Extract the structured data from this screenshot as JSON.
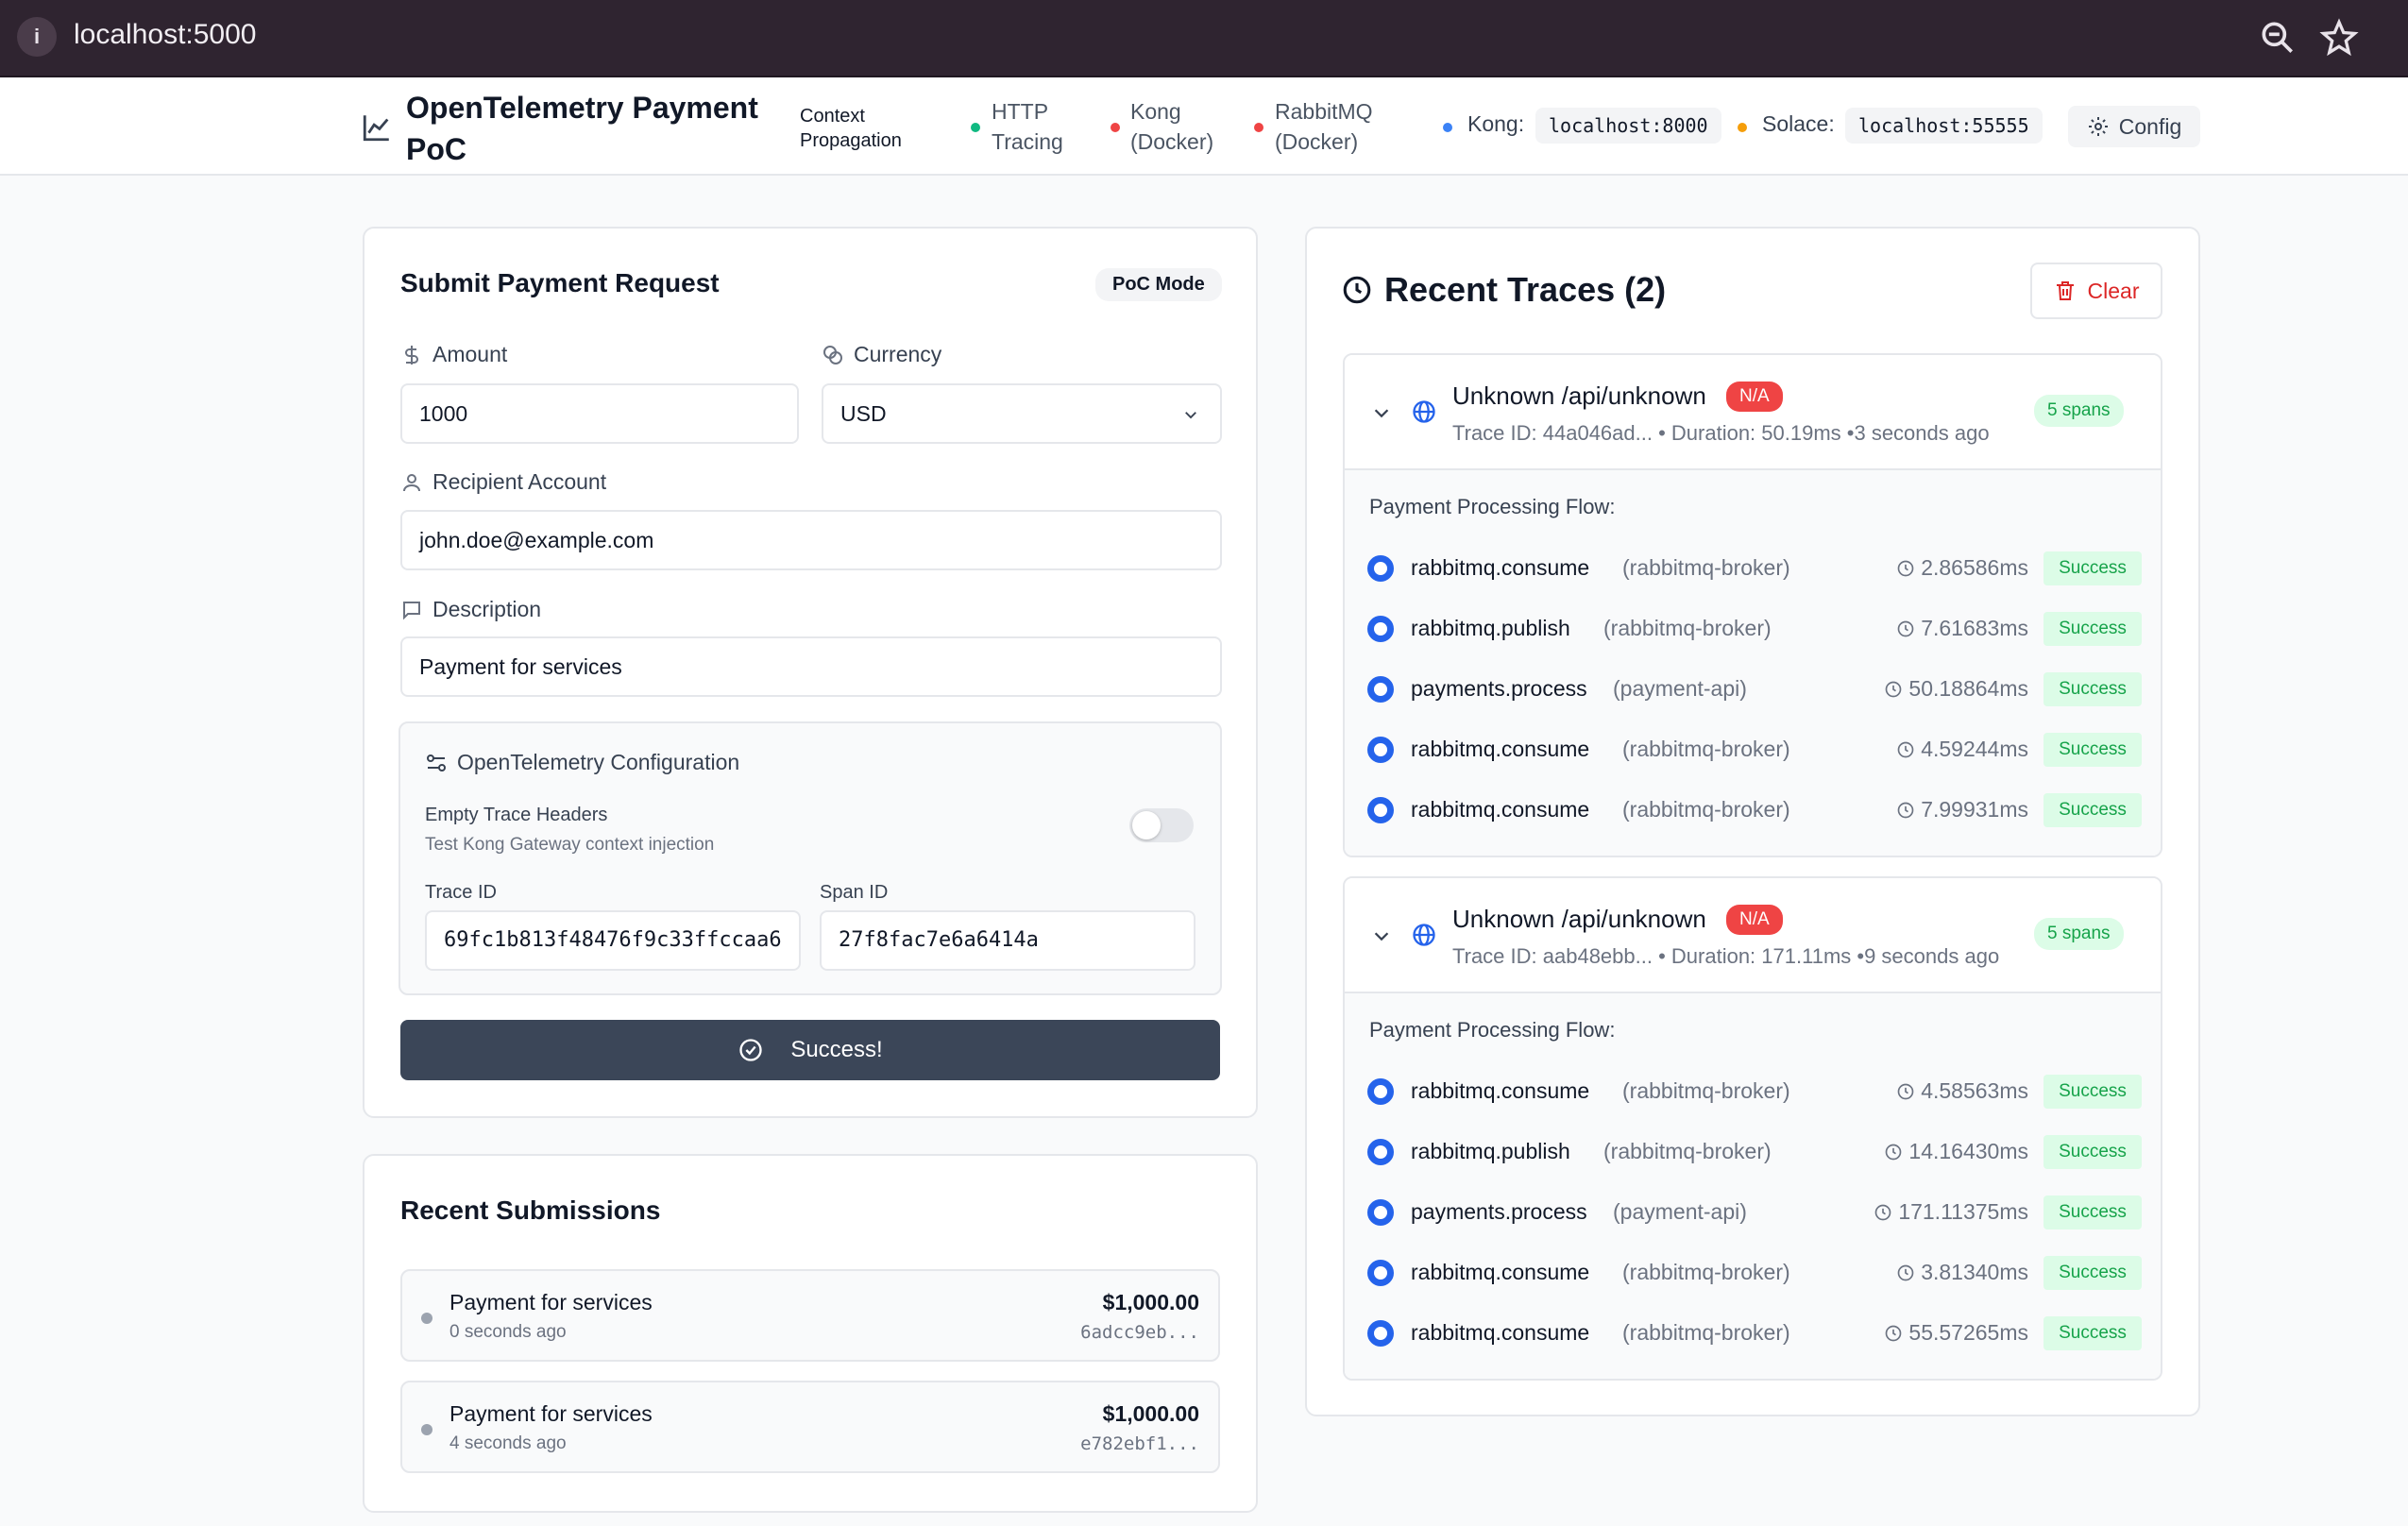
{
  "browser": {
    "url": "localhost:5000"
  },
  "header": {
    "title": "OpenTelemetry Payment PoC",
    "context_propagation": "Context Propagation",
    "http_tracing": "HTTP Tracing",
    "kong_docker": "Kong (Docker)",
    "rabbitmq_docker": "RabbitMQ (Docker)",
    "kong_label": "Kong:",
    "kong_endpoint": "localhost:8000",
    "solace_label": "Solace:",
    "solace_endpoint": "localhost:55555",
    "config_label": "Config",
    "colors": {
      "http": "#10b981",
      "kong": "#ef4444",
      "rabbitmq": "#ef4444",
      "kong_dot": "#3b82f6",
      "solace_dot": "#f59e0b"
    }
  },
  "form": {
    "title": "Submit Payment Request",
    "mode_badge": "PoC Mode",
    "amount_label": "Amount",
    "amount_value": "1000",
    "currency_label": "Currency",
    "currency_value": "USD",
    "recipient_label": "Recipient Account",
    "recipient_value": "john.doe@example.com",
    "description_label": "Description",
    "description_value": "Payment for services",
    "otel": {
      "title": "OpenTelemetry Configuration",
      "empty_headers_label": "Empty Trace Headers",
      "empty_headers_hint": "Test Kong Gateway context injection",
      "empty_headers_enabled": false,
      "trace_id_label": "Trace ID",
      "trace_id_value": "69fc1b813f48476f9c33ffccaa6",
      "span_id_label": "Span ID",
      "span_id_value": "27f8fac7e6a6414a"
    },
    "submit_label": "Success!"
  },
  "submissions": {
    "title": "Recent Submissions",
    "items": [
      {
        "title": "Payment for services",
        "time": "0 seconds ago",
        "amount": "$1,000.00",
        "hash": "6adcc9eb..."
      },
      {
        "title": "Payment for services",
        "time": "4 seconds ago",
        "amount": "$1,000.00",
        "hash": "e782ebf1..."
      }
    ]
  },
  "traces": {
    "title": "Recent Traces (2)",
    "clear_label": "Clear",
    "flow_label": "Payment Processing Flow:",
    "items": [
      {
        "name": "Unknown /api/unknown",
        "badge": "N/A",
        "meta": "Trace ID: 44a046ad... • Duration: 50.19ms •3 seconds ago",
        "spans_badge": "5 spans",
        "spans": [
          {
            "name": "rabbitmq.consume",
            "service": "(rabbitmq-broker)",
            "duration": "2.86586ms",
            "status": "Success"
          },
          {
            "name": "rabbitmq.publish",
            "service": "(rabbitmq-broker)",
            "duration": "7.61683ms",
            "status": "Success"
          },
          {
            "name": "payments.process",
            "service": "(payment-api)",
            "duration": "50.18864ms",
            "status": "Success"
          },
          {
            "name": "rabbitmq.consume",
            "service": "(rabbitmq-broker)",
            "duration": "4.59244ms",
            "status": "Success"
          },
          {
            "name": "rabbitmq.consume",
            "service": "(rabbitmq-broker)",
            "duration": "7.99931ms",
            "status": "Success"
          }
        ]
      },
      {
        "name": "Unknown /api/unknown",
        "badge": "N/A",
        "meta": "Trace ID: aab48ebb... • Duration: 171.11ms •9 seconds ago",
        "spans_badge": "5 spans",
        "spans": [
          {
            "name": "rabbitmq.consume",
            "service": "(rabbitmq-broker)",
            "duration": "4.58563ms",
            "status": "Success"
          },
          {
            "name": "rabbitmq.publish",
            "service": "(rabbitmq-broker)",
            "duration": "14.16430ms",
            "status": "Success"
          },
          {
            "name": "payments.process",
            "service": "(payment-api)",
            "duration": "171.11375ms",
            "status": "Success"
          },
          {
            "name": "rabbitmq.consume",
            "service": "(rabbitmq-broker)",
            "duration": "3.81340ms",
            "status": "Success"
          },
          {
            "name": "rabbitmq.consume",
            "service": "(rabbitmq-broker)",
            "duration": "55.57265ms",
            "status": "Success"
          }
        ]
      }
    ]
  }
}
